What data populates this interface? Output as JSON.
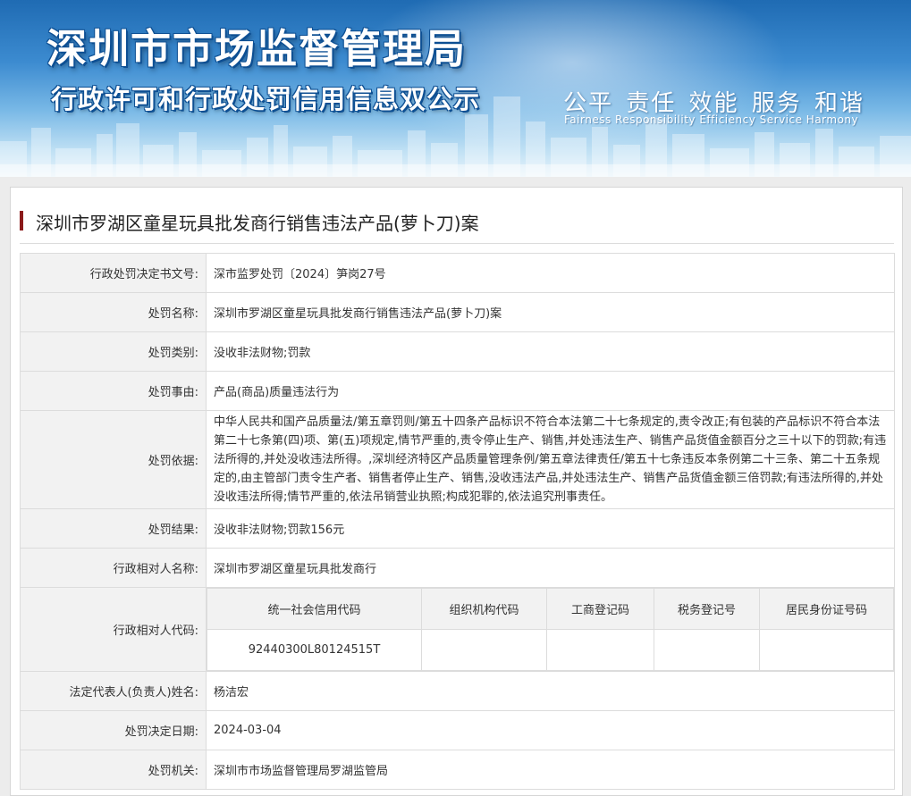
{
  "banner": {
    "title": "深圳市市场监督管理局",
    "subtitle": "行政许可和行政处罚信用信息双公示",
    "slogan": "公平 责任 效能 服务 和谐",
    "slogan_en": "Fairness Responsibility Efficiency Service Harmony"
  },
  "case_title": "深圳市罗湖区童星玩具批发商行销售违法产品(萝卜刀)案",
  "rows": {
    "doc_no": {
      "label": "行政处罚决定书文号:",
      "value": "深市监罗处罚〔2024〕笋岗27号"
    },
    "name": {
      "label": "处罚名称:",
      "value": "深圳市罗湖区童星玩具批发商行销售违法产品(萝卜刀)案"
    },
    "category": {
      "label": "处罚类别:",
      "value": "没收非法财物;罚款"
    },
    "reason": {
      "label": "处罚事由:",
      "value": "产品(商品)质量违法行为"
    },
    "basis": {
      "label": "处罚依据:",
      "value": "中华人民共和国产品质量法/第五章罚则/第五十四条产品标识不符合本法第二十七条规定的,责令改正;有包装的产品标识不符合本法第二十七条第(四)项、第(五)项规定,情节严重的,责令停止生产、销售,并处违法生产、销售产品货值金额百分之三十以下的罚款;有违法所得的,并处没收违法所得。,深圳经济特区产品质量管理条例/第五章法律责任/第五十七条违反本条例第二十三条、第二十五条规定的,由主管部门责令生产者、销售者停止生产、销售,没收违法产品,并处违法生产、销售产品货值金额三倍罚款;有违法所得的,并处没收违法所得;情节严重的,依法吊销营业执照;构成犯罪的,依法追究刑事责任。"
    },
    "result": {
      "label": "处罚结果:",
      "value": "没收非法财物;罚款156元"
    },
    "party_name": {
      "label": "行政相对人名称:",
      "value": "深圳市罗湖区童星玩具批发商行"
    },
    "party_code": {
      "label": "行政相对人代码:",
      "headers": [
        "统一社会信用代码",
        "组织机构代码",
        "工商登记码",
        "税务登记号",
        "居民身份证号码"
      ],
      "values": [
        "92440300L80124515T",
        "",
        "",
        "",
        ""
      ]
    },
    "legal_rep": {
      "label": "法定代表人(负责人)姓名:",
      "value": "杨洁宏"
    },
    "date": {
      "label": "处罚决定日期:",
      "value": "2024-03-04"
    },
    "authority": {
      "label": "处罚机关:",
      "value": "深圳市市场监督管理局罗湖监管局"
    }
  }
}
